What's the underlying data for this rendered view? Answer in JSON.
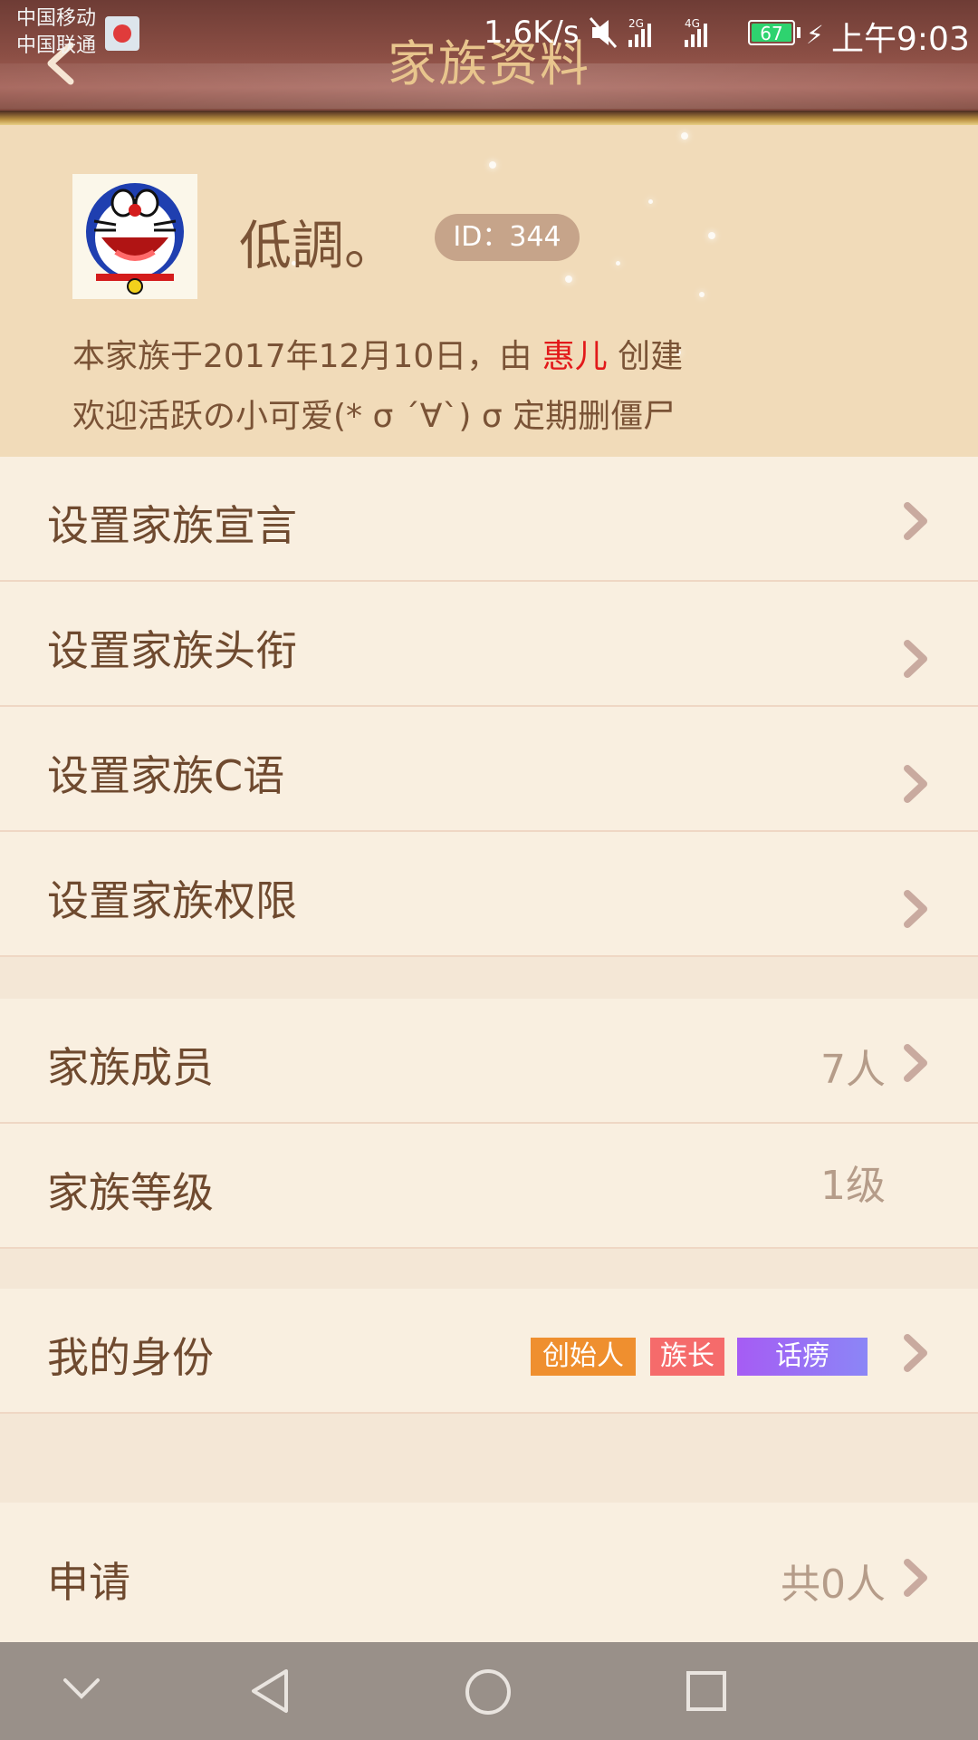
{
  "status_bar": {
    "carrier1": "中国移动",
    "carrier2": "中国联通",
    "net_speed": "1.6K/s",
    "network1": "2G",
    "network2": "4G",
    "battery": "67",
    "time": "上午9:03"
  },
  "header": {
    "title": "家族资料"
  },
  "profile": {
    "name": "低調。",
    "id_label": "ID：344",
    "created_prefix": "本家族于2017年12月10日，由 ",
    "creator": "惠儿",
    "created_suffix": " 创建",
    "motto": "欢迎活跃の小可爱(* σ ´∀`) σ 定期删僵尸"
  },
  "settings": [
    {
      "label": "设置家族宣言"
    },
    {
      "label": "设置家族头衔"
    },
    {
      "label": "设置家族C语"
    },
    {
      "label": "设置家族权限"
    }
  ],
  "info": {
    "members_label": "家族成员",
    "members_value": "7人",
    "level_label": "家族等级",
    "level_value": "1级"
  },
  "identity": {
    "label": "我的身份",
    "tags": [
      "创始人",
      "族长",
      "话痨"
    ]
  },
  "apply": {
    "label": "申请",
    "value": "共0人"
  },
  "icons": {
    "back": "back-arrow-icon",
    "chevron": "chevron-right-icon",
    "nav_down": "chevron-down-icon",
    "nav_back": "triangle-back-icon",
    "nav_home": "circle-home-icon",
    "nav_recent": "square-recent-icon"
  },
  "colors": {
    "header": "#8c4f45",
    "title": "#e8c58d",
    "profile_bg": "#f1dbb9",
    "row_bg": "#f9efe0",
    "text": "#6f4a2f",
    "creator": "#e2191a"
  }
}
